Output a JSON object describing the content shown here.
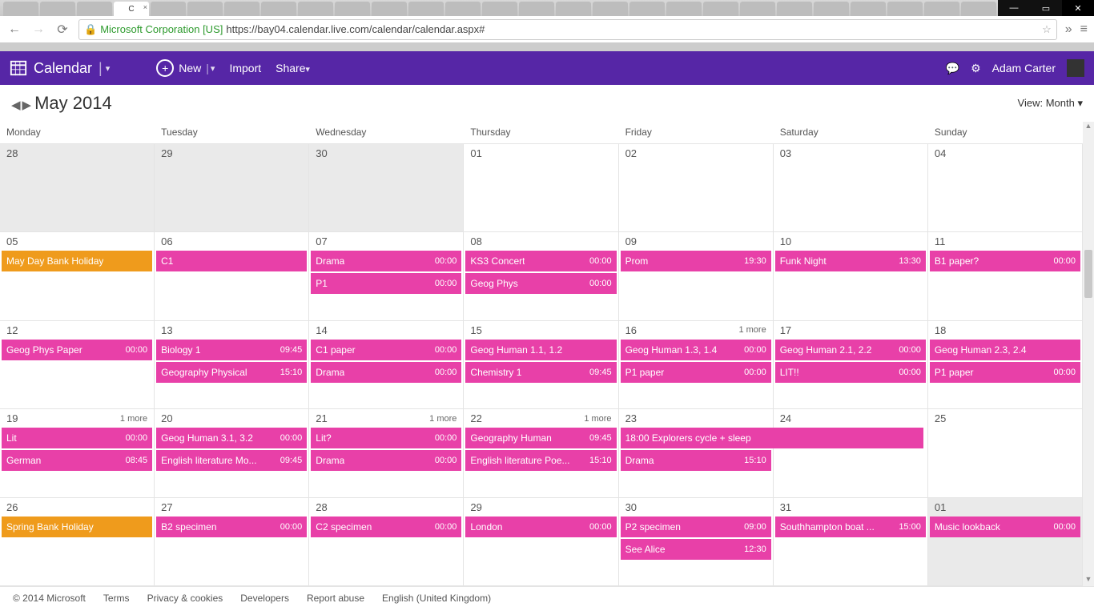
{
  "browser": {
    "active_tab_label": "C",
    "ssl_badge": "Microsoft Corporation [US]",
    "url": "https://bay04.calendar.live.com/calendar/calendar.aspx#"
  },
  "header": {
    "app_name": "Calendar",
    "new_label": "New",
    "import_label": "Import",
    "share_label": "Share",
    "user_name": "Adam Carter"
  },
  "subheader": {
    "month_label": "May 2014",
    "view_label": "View:",
    "view_value": "Month"
  },
  "weekdays": [
    "Monday",
    "Tuesday",
    "Wednesday",
    "Thursday",
    "Friday",
    "Saturday",
    "Sunday"
  ],
  "weeks": [
    [
      {
        "day": "28",
        "outside": true,
        "events": []
      },
      {
        "day": "29",
        "outside": true,
        "events": []
      },
      {
        "day": "30",
        "outside": true,
        "events": []
      },
      {
        "day": "01",
        "outside": false,
        "events": []
      },
      {
        "day": "02",
        "outside": false,
        "events": []
      },
      {
        "day": "03",
        "outside": false,
        "events": []
      },
      {
        "day": "04",
        "outside": false,
        "events": []
      }
    ],
    [
      {
        "day": "05",
        "outside": false,
        "events": [
          {
            "title": "May Day Bank Holiday",
            "color": "orange"
          }
        ]
      },
      {
        "day": "06",
        "outside": false,
        "events": [
          {
            "title": "C1",
            "color": "pink"
          }
        ]
      },
      {
        "day": "07",
        "outside": false,
        "events": [
          {
            "title": "Drama",
            "time": "00:00",
            "color": "pink"
          },
          {
            "title": "P1",
            "time": "00:00",
            "color": "pink"
          }
        ]
      },
      {
        "day": "08",
        "outside": false,
        "events": [
          {
            "title": "KS3 Concert",
            "time": "00:00",
            "color": "pink"
          },
          {
            "title": "Geog Phys",
            "time": "00:00",
            "color": "pink"
          }
        ]
      },
      {
        "day": "09",
        "outside": false,
        "events": [
          {
            "title": "Prom",
            "time": "19:30",
            "color": "pink"
          }
        ]
      },
      {
        "day": "10",
        "outside": false,
        "events": [
          {
            "title": "Funk Night",
            "time": "13:30",
            "color": "pink"
          }
        ]
      },
      {
        "day": "11",
        "outside": false,
        "events": [
          {
            "title": "B1 paper?",
            "time": "00:00",
            "color": "pink"
          }
        ]
      }
    ],
    [
      {
        "day": "12",
        "outside": false,
        "events": [
          {
            "title": "Geog Phys Paper",
            "time": "00:00",
            "color": "pink"
          }
        ]
      },
      {
        "day": "13",
        "outside": false,
        "events": [
          {
            "title": "Biology 1",
            "time": "09:45",
            "color": "pink"
          },
          {
            "title": "Geography Physical",
            "time": "15:10",
            "color": "pink"
          }
        ]
      },
      {
        "day": "14",
        "outside": false,
        "events": [
          {
            "title": "C1 paper",
            "time": "00:00",
            "color": "pink"
          },
          {
            "title": "Drama",
            "time": "00:00",
            "color": "pink"
          }
        ]
      },
      {
        "day": "15",
        "outside": false,
        "events": [
          {
            "title": "Geog Human 1.1, 1.2",
            "color": "pink"
          },
          {
            "title": "Chemistry 1",
            "time": "09:45",
            "color": "pink"
          }
        ]
      },
      {
        "day": "16",
        "outside": false,
        "more": "1 more",
        "events": [
          {
            "title": "Geog Human 1.3, 1.4",
            "time": "00:00",
            "color": "pink"
          },
          {
            "title": "P1 paper",
            "time": "00:00",
            "color": "pink"
          }
        ]
      },
      {
        "day": "17",
        "outside": false,
        "events": [
          {
            "title": "Geog Human 2.1, 2.2",
            "time": "00:00",
            "color": "pink"
          },
          {
            "title": "LIT!!",
            "time": "00:00",
            "color": "pink"
          }
        ]
      },
      {
        "day": "18",
        "outside": false,
        "events": [
          {
            "title": "Geog Human 2.3, 2.4",
            "color": "pink"
          },
          {
            "title": "P1 paper",
            "time": "00:00",
            "color": "pink"
          }
        ]
      }
    ],
    [
      {
        "day": "19",
        "outside": false,
        "more": "1 more",
        "events": [
          {
            "title": "Lit",
            "time": "00:00",
            "color": "pink"
          },
          {
            "title": "German",
            "time": "08:45",
            "color": "pink"
          }
        ]
      },
      {
        "day": "20",
        "outside": false,
        "events": [
          {
            "title": "Geog Human 3.1, 3.2",
            "time": "00:00",
            "color": "pink"
          },
          {
            "title": "English literature Mo...",
            "time": "09:45",
            "color": "pink"
          }
        ]
      },
      {
        "day": "21",
        "outside": false,
        "more": "1 more",
        "events": [
          {
            "title": "Lit?",
            "time": "00:00",
            "color": "pink"
          },
          {
            "title": "Drama",
            "time": "00:00",
            "color": "pink"
          }
        ]
      },
      {
        "day": "22",
        "outside": false,
        "more": "1 more",
        "events": [
          {
            "title": "Geography Human",
            "time": "09:45",
            "color": "pink"
          },
          {
            "title": "English literature Poe...",
            "time": "15:10",
            "color": "pink"
          }
        ]
      },
      {
        "day": "23",
        "outside": false,
        "events": [
          {
            "span": true,
            "title": "18:00  Explorers cycle + sleep",
            "color": "pink"
          },
          {
            "title": "Drama",
            "time": "15:10",
            "color": "pink"
          }
        ]
      },
      {
        "day": "24",
        "outside": false,
        "events": []
      },
      {
        "day": "25",
        "outside": false,
        "events": []
      }
    ],
    [
      {
        "day": "26",
        "outside": false,
        "events": [
          {
            "title": "Spring Bank Holiday",
            "color": "orange"
          }
        ]
      },
      {
        "day": "27",
        "outside": false,
        "events": [
          {
            "title": "B2 specimen",
            "time": "00:00",
            "color": "pink"
          }
        ]
      },
      {
        "day": "28",
        "outside": false,
        "events": [
          {
            "title": "C2 specimen",
            "time": "00:00",
            "color": "pink"
          }
        ]
      },
      {
        "day": "29",
        "outside": false,
        "events": [
          {
            "title": "London",
            "time": "00:00",
            "color": "pink"
          }
        ]
      },
      {
        "day": "30",
        "outside": false,
        "events": [
          {
            "title": "P2 specimen",
            "time": "09:00",
            "color": "pink"
          },
          {
            "title": "See Alice",
            "time": "12:30",
            "color": "pink"
          }
        ]
      },
      {
        "day": "31",
        "outside": false,
        "events": [
          {
            "title": "Southhampton boat ...",
            "time": "15:00",
            "color": "pink"
          }
        ]
      },
      {
        "day": "01",
        "outside": true,
        "events": [
          {
            "title": "Music lookback",
            "time": "00:00",
            "color": "pink"
          }
        ]
      }
    ]
  ],
  "footer": {
    "copyright": "© 2014 Microsoft",
    "terms": "Terms",
    "privacy": "Privacy & cookies",
    "developers": "Developers",
    "report": "Report abuse",
    "locale": "English (United Kingdom)"
  }
}
